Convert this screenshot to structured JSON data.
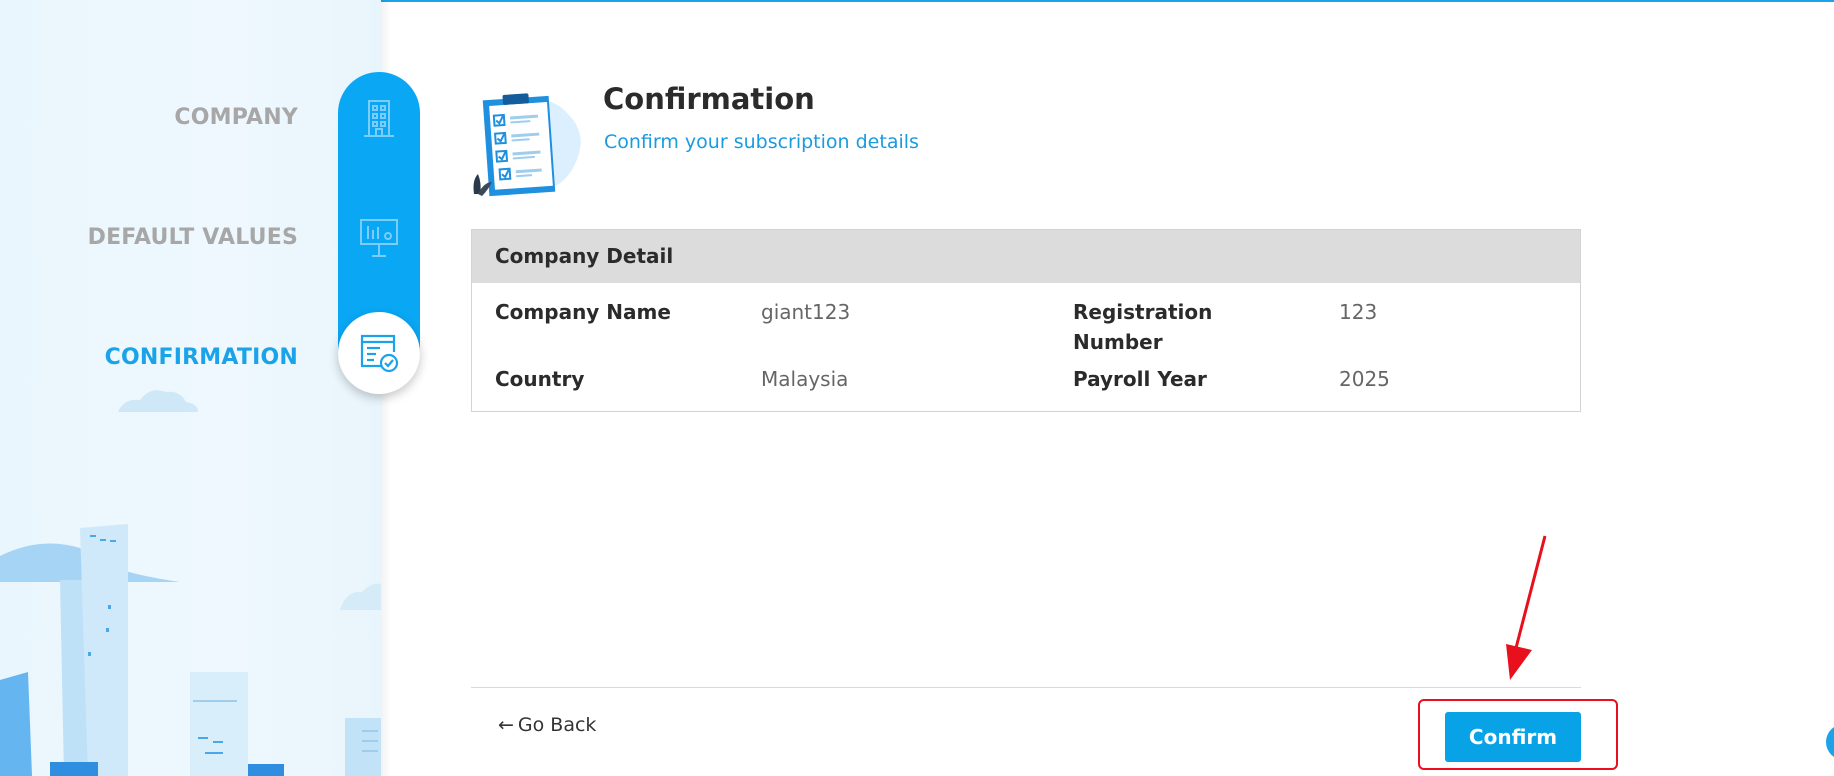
{
  "colors": {
    "accent": "#1aa3e8",
    "primary_button": "#07a3e6",
    "sidebar_pill": "#0aa7f5",
    "annotation": "#e8101c"
  },
  "steps": [
    {
      "label": "COMPANY",
      "icon": "building-icon",
      "active": false
    },
    {
      "label": "DEFAULT VALUES",
      "icon": "presentation-board-icon",
      "active": false
    },
    {
      "label": "CONFIRMATION",
      "icon": "certificate-check-icon",
      "active": true
    }
  ],
  "header": {
    "title": "Confirmation",
    "subtitle": "Confirm your subscription details",
    "illustration": "clipboard-checklist-icon"
  },
  "company_detail": {
    "heading": "Company Detail",
    "fields": [
      {
        "label": "Company Name",
        "value": "giant123"
      },
      {
        "label": "Registration Number",
        "value": "123"
      },
      {
        "label": "Country",
        "value": "Malaysia"
      },
      {
        "label": "Payroll Year",
        "value": "2025"
      }
    ]
  },
  "footer": {
    "back_icon": "arrow-left-icon",
    "back_arrow": "←",
    "back_label": "Go Back",
    "confirm_label": "Confirm"
  }
}
